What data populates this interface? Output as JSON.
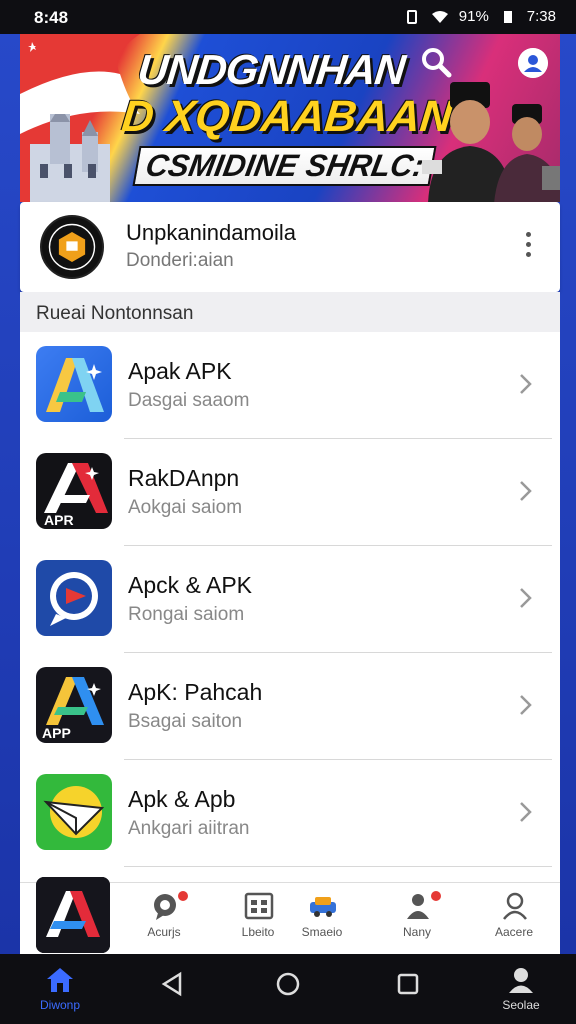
{
  "status_bar": {
    "time": "8:48",
    "battery": "91%",
    "clock": "7:38"
  },
  "banner": {
    "line1": "UNDGNNHAN",
    "line2": "D XQDAABAAN",
    "line3": "CSMIDINE SHRLC:"
  },
  "header_card": {
    "title": "Unpkanindamoila",
    "subtitle": "Donderi:aian"
  },
  "section": {
    "label": "Rueai Nontonnsan"
  },
  "apps": [
    {
      "title": "Apak APK",
      "subtitle": "Dasgai saaom",
      "icon": "a-gradient-icon"
    },
    {
      "title": "RakDAnpn",
      "subtitle": "Aokgai saiom",
      "icon": "apr-red-icon",
      "icon_text": "APR"
    },
    {
      "title": "Apck & APK",
      "subtitle": "Rongai saiom",
      "icon": "chat-bubble-icon"
    },
    {
      "title": "ApK: Pahcah",
      "subtitle": "Bsagai saiton",
      "icon": "a-gradient-dark-icon",
      "icon_text": "APP"
    },
    {
      "title": "Apk & Apb",
      "subtitle": "Ankgari aiitran",
      "icon": "paper-plane-icon"
    }
  ],
  "tabs": [
    {
      "label": "Acurjs",
      "icon": "chat-icon",
      "badge": true
    },
    {
      "label": "Lbeito",
      "icon": "grid-icon",
      "badge": false
    },
    {
      "label": "Smaeio",
      "icon": "car-icon",
      "badge": false
    },
    {
      "label": "Nany",
      "icon": "user-icon",
      "badge": true
    },
    {
      "label": "Aacere",
      "icon": "profile-icon",
      "badge": false
    }
  ],
  "nav": {
    "home_label": "Diwonp",
    "account_label": "Seolae"
  },
  "colors": {
    "accent": "#3b6bff",
    "brand_blue": "#1f3fb5",
    "badge": "#e53935"
  }
}
